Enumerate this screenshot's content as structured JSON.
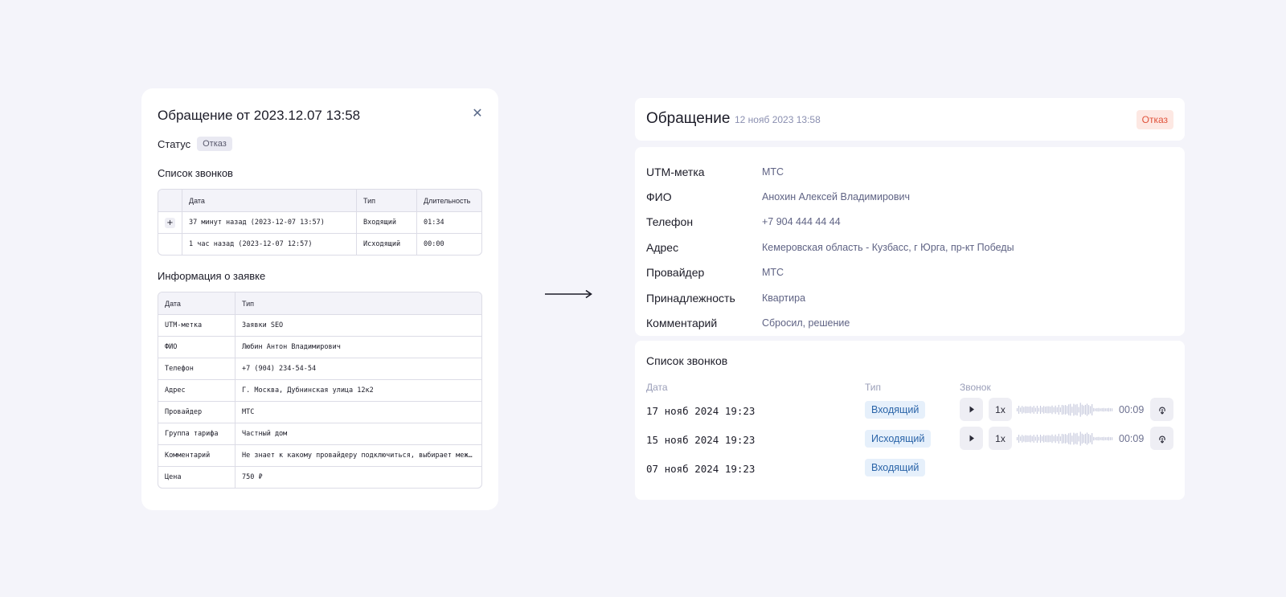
{
  "left_modal": {
    "title": "Обращение от 2023.12.07 13:58",
    "close_glyph": "✕",
    "status_label": "Статус",
    "status_value": "Отказ",
    "calls_title": "Список звонков",
    "calls_headers": [
      "",
      "Дата",
      "Тип",
      "Длительность"
    ],
    "calls_rows": [
      {
        "expand": "+",
        "date": "37 минут назад (2023-12-07 13:57)",
        "type": "Входящий",
        "duration": "01:34"
      },
      {
        "expand": "",
        "date": "1 час назад (2023-12-07 12:57)",
        "type": "Исходящий",
        "duration": "00:00"
      }
    ],
    "info_title": "Информация о заявке",
    "info_headers": [
      "Дата",
      "Тип"
    ],
    "info_rows": [
      {
        "key": "UTM-метка",
        "value": "Заявки SEO"
      },
      {
        "key": "ФИО",
        "value": "Любин Антон Владимирович"
      },
      {
        "key": "Телефон",
        "value": "+7 (904) 234-54-54"
      },
      {
        "key": "Адрес",
        "value": "Г. Москва, Дубнинская улица 12к2"
      },
      {
        "key": "Провайдер",
        "value": "МТС"
      },
      {
        "key": "Группа тарифа",
        "value": "Частный дом"
      },
      {
        "key": "Комментарий",
        "value": "Не знает к какому провайдеру подключиться, выбирает между…"
      },
      {
        "key": "Цена",
        "value": "750 ₽"
      }
    ]
  },
  "right": {
    "title": "Обращение",
    "date": "12 нояб 2023 13:58",
    "status": "Отказ",
    "info": [
      {
        "label": "UTM-метка",
        "value": "МТС"
      },
      {
        "label": "ФИО",
        "value": "Анохин Алексей Владимирович"
      },
      {
        "label": "Телефон",
        "value": "+7 904 444 44 44"
      },
      {
        "label": "Адрес",
        "value": "Кемеровская область - Кузбасс, г Юрга, пр-кт Победы"
      },
      {
        "label": "Провайдер",
        "value": "МТС"
      },
      {
        "label": "Принадлежность",
        "value": "Квартира"
      },
      {
        "label": "Комментарий",
        "value": "Сбросил, решение"
      }
    ],
    "calls_title": "Список звонков",
    "calls_headers": {
      "date": "Дата",
      "type": "Тип",
      "call": "Звонок"
    },
    "calls": [
      {
        "date": "17 нояб 2024 19:23",
        "type": "Входящий",
        "has_audio": true,
        "speed": "1x",
        "duration": "00:09"
      },
      {
        "date": "15 нояб 2024 19:23",
        "type": "Исходящий",
        "has_audio": true,
        "speed": "1x",
        "duration": "00:09"
      },
      {
        "date": "07 нояб 2024 19:23",
        "type": "Входящий",
        "has_audio": false
      }
    ]
  },
  "icons": {
    "play": "play-icon",
    "download": "download-icon",
    "arrow": "arrow-right-icon"
  },
  "colors": {
    "background": "#f4f4fa",
    "refusal_bg": "#fde8e3",
    "refusal_text": "#e0523a",
    "call_badge_bg": "#e6f0fb",
    "call_badge_text": "#2a64a8",
    "muted": "#8a8fb0"
  }
}
